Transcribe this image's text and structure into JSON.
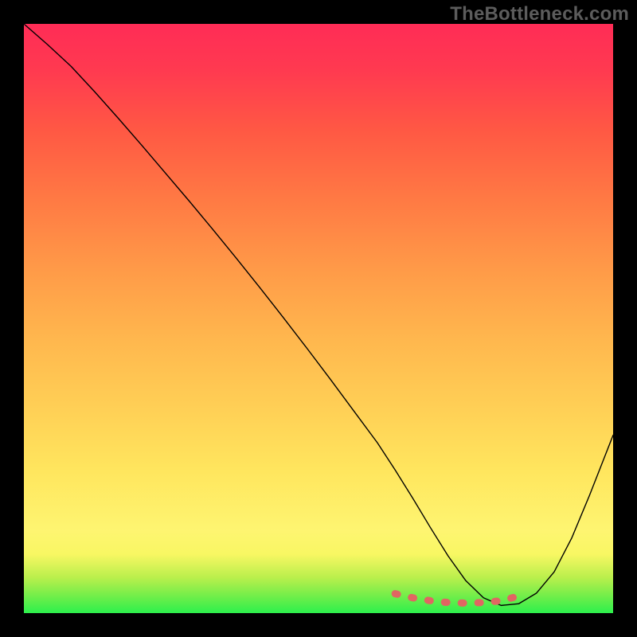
{
  "watermark": "TheBottleneck.com",
  "chart_data": {
    "type": "line",
    "title": "",
    "xlabel": "",
    "ylabel": "",
    "xlim": [
      0,
      100
    ],
    "ylim": [
      0,
      100
    ],
    "grid": false,
    "gradient_background": {
      "top": "#ff2c56",
      "bottom": "#2cf04c",
      "meaning": "high-to-low bottleneck severity"
    },
    "series": [
      {
        "name": "curve",
        "color": "#000000",
        "stroke_width": 1.4,
        "x": [
          0,
          4,
          8,
          12,
          16,
          20,
          24,
          28,
          32,
          36,
          40,
          44,
          48,
          52,
          56,
          60,
          63,
          66,
          69,
          72,
          75,
          78,
          81,
          84,
          87,
          90,
          93,
          96,
          100
        ],
        "y": [
          100,
          96.5,
          92.8,
          88.5,
          84.0,
          79.4,
          74.7,
          70.0,
          65.2,
          60.3,
          55.3,
          50.2,
          45.0,
          39.7,
          34.3,
          28.9,
          24.3,
          19.5,
          14.5,
          9.7,
          5.5,
          2.6,
          1.3,
          1.6,
          3.4,
          7.0,
          12.8,
          20.0,
          30.2
        ]
      },
      {
        "name": "optimal-region",
        "color": "#e06662",
        "stroke_width": 9,
        "style": "dotted",
        "x": [
          63,
          66,
          69,
          72,
          75,
          78,
          81,
          84
        ],
        "y": [
          3.3,
          2.6,
          2.1,
          1.8,
          1.7,
          1.8,
          2.1,
          2.9
        ]
      }
    ],
    "legend": null
  }
}
